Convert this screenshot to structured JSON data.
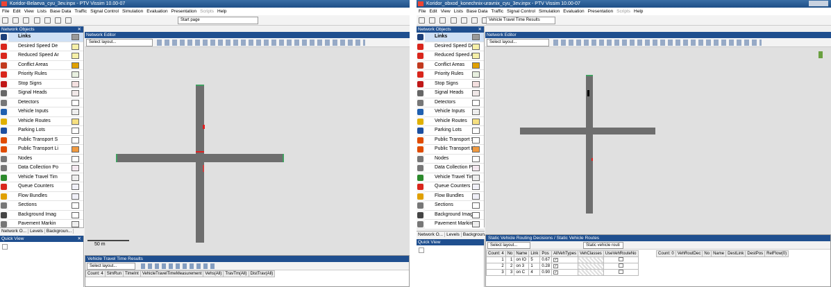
{
  "left_window": {
    "title": "Koridor-Belaeva_cyu_3ev.inpx - PTV Vissim 10.00-07",
    "menu": [
      "File",
      "Edit",
      "View",
      "Lists",
      "Base Data",
      "Traffic",
      "Signal Control",
      "Simulation",
      "Evaluation",
      "Presentation",
      "Scripts",
      "Help"
    ],
    "toolbar_select": "Start page",
    "network_objects_title": "Network Objects",
    "network_editor_title": "Network Editor",
    "layout_select": "Select layout...",
    "scale_label": "50 m",
    "objects": [
      {
        "label": "Links",
        "selected": true,
        "icon_color": "#1c3f7a",
        "swatch": "#9a9a9a"
      },
      {
        "label": "Desired Speed De",
        "icon_color": "#d9261c",
        "swatch": "#f6f0a8"
      },
      {
        "label": "Reduced Speed Ar",
        "icon_color": "#d9261c",
        "swatch": "#f6f0a8"
      },
      {
        "label": "Conflict Areas",
        "icon_color": "#c23a1f",
        "swatch": "#e0a000"
      },
      {
        "label": "Priority Rules",
        "icon_color": "#d9261c",
        "swatch": "#e8f0e0"
      },
      {
        "label": "Stop Signs",
        "icon_color": "#c01818",
        "swatch": "#f4e0e0"
      },
      {
        "label": "Signal Heads",
        "icon_color": "#666666",
        "swatch": "#f0e8e8"
      },
      {
        "label": "Detectors",
        "icon_color": "#777777",
        "swatch": "#ffffff"
      },
      {
        "label": "Vehicle Inputs",
        "icon_color": "#2060b0",
        "swatch": "#eeeeee"
      },
      {
        "label": "Vehicle Routes",
        "icon_color": "#e0b000",
        "swatch": "#f6e080"
      },
      {
        "label": "Parking Lots",
        "icon_color": "#1c4fa0",
        "swatch": "#ffffff"
      },
      {
        "label": "Public Transport S",
        "icon_color": "#e04c00",
        "swatch": "#ffffff"
      },
      {
        "label": "Public Transport Li",
        "icon_color": "#e04c00",
        "swatch": "#f09a40"
      },
      {
        "label": "Nodes",
        "icon_color": "#777777",
        "swatch": "#ffffff"
      },
      {
        "label": "Data Collection Po",
        "icon_color": "#777777",
        "swatch": "#f4e8f0"
      },
      {
        "label": "Vehicle Travel Tim",
        "icon_color": "#2c8a2c",
        "swatch": "#eeeeee"
      },
      {
        "label": "Queue Counters",
        "icon_color": "#d9261c",
        "swatch": "#f0f0f8"
      },
      {
        "label": "Flow Bundles",
        "icon_color": "#e0a000",
        "swatch": "#f0f0f8"
      },
      {
        "label": "Sections",
        "icon_color": "#777777",
        "swatch": "#ffffff"
      },
      {
        "label": "Background Imag",
        "icon_color": "#444444",
        "swatch": "#ffffff"
      },
      {
        "label": "Pavement Markin",
        "icon_color": "#777777",
        "swatch": "#eeeeee"
      }
    ],
    "bottom_tabs": [
      "Network O...",
      "Levels",
      "Backgroun..."
    ],
    "quick_view_title": "Quick View",
    "results_title": "Vehicle Travel Time Results",
    "results_layout_select": "Select layout...",
    "results_count": "Count: 4",
    "results_columns": [
      "SimRun",
      "TimeInt",
      "VehicleTravelTimeMeasurement",
      "Vehs(All)",
      "TravTm(All)",
      "DistTrav(All)"
    ]
  },
  "right_window": {
    "title": "Koridor_obxod_konechnix-uravnix_cyu_3ev.inpx - PTV Vissim 10.00-07",
    "menu": [
      "File",
      "Edit",
      "View",
      "Lists",
      "Base Data",
      "Traffic",
      "Signal Control",
      "Simulation",
      "Evaluation",
      "Presentation",
      "Scripts",
      "Help"
    ],
    "toolbar_select": "Vehicle Travel Time Results",
    "network_objects_title": "Network Objects",
    "network_editor_title": "Network Editor",
    "layout_select": "Select layout...",
    "objects": [
      {
        "label": "Links",
        "selected": true,
        "icon_color": "#1c3f7a",
        "swatch": "#9a9a9a"
      },
      {
        "label": "Desired Speed De",
        "icon_color": "#d9261c",
        "swatch": "#f6f0a8"
      },
      {
        "label": "Reduced Speed Ar",
        "icon_color": "#d9261c",
        "swatch": "#f6f0a8"
      },
      {
        "label": "Conflict Areas",
        "icon_color": "#c23a1f",
        "swatch": "#e0a000"
      },
      {
        "label": "Priority Rules",
        "icon_color": "#d9261c",
        "swatch": "#e8f0e0"
      },
      {
        "label": "Stop Signs",
        "icon_color": "#c01818",
        "swatch": "#f4e0e0"
      },
      {
        "label": "Signal Heads",
        "icon_color": "#666666",
        "swatch": "#f0e8e8"
      },
      {
        "label": "Detectors",
        "icon_color": "#777777",
        "swatch": "#ffffff"
      },
      {
        "label": "Vehicle Inputs",
        "icon_color": "#2060b0",
        "swatch": "#eeeeee"
      },
      {
        "label": "Vehicle Routes",
        "icon_color": "#e0b000",
        "swatch": "#f6e080"
      },
      {
        "label": "Parking Lots",
        "icon_color": "#1c4fa0",
        "swatch": "#ffffff"
      },
      {
        "label": "Public Transport S",
        "icon_color": "#e04c00",
        "swatch": "#ffffff"
      },
      {
        "label": "Public Transport Li",
        "icon_color": "#e04c00",
        "swatch": "#f09a40"
      },
      {
        "label": "Nodes",
        "icon_color": "#777777",
        "swatch": "#ffffff"
      },
      {
        "label": "Data Collection Po",
        "icon_color": "#777777",
        "swatch": "#f4e8f0"
      },
      {
        "label": "Vehicle Travel Tim",
        "icon_color": "#2c8a2c",
        "swatch": "#eeeeee"
      },
      {
        "label": "Queue Counters",
        "icon_color": "#d9261c",
        "swatch": "#f0f0f8"
      },
      {
        "label": "Flow Bundles",
        "icon_color": "#e0a000",
        "swatch": "#f0f0f8"
      },
      {
        "label": "Sections",
        "icon_color": "#777777",
        "swatch": "#ffffff"
      },
      {
        "label": "Background Imag",
        "icon_color": "#444444",
        "swatch": "#ffffff"
      },
      {
        "label": "Pavement Markin",
        "icon_color": "#777777",
        "swatch": "#eeeeee"
      }
    ],
    "bottom_tabs": [
      "Network O...",
      "Levels",
      "Backgroun..."
    ],
    "quick_view_title": "Quick View",
    "routes_title": "Static Vehicle Routing Decisions / Static Vehicle Routes",
    "routes_layout_select": "Select layout...",
    "routes_filter_select": "Static vehicle routi",
    "routes_count": "Count: 4",
    "routes_columns": [
      "No",
      "Name",
      "Link",
      "Pos",
      "AllVehTypes",
      "VehClasses",
      "UseVehRouteNo"
    ],
    "routes_rows": [
      {
        "idx": "1",
        "no": "1",
        "name": "on IO",
        "link": "5",
        "pos": "0.67",
        "allveh": "✓"
      },
      {
        "idx": "2",
        "no": "2",
        "name": "on 3",
        "link": "1",
        "pos": "0.28",
        "allveh": "✓"
      },
      {
        "idx": "3",
        "no": "3",
        "name": "on C",
        "link": "4",
        "pos": "0.90",
        "allveh": "✓"
      }
    ],
    "routes2_count": "Count: 0",
    "routes2_columns": [
      "VehRoutDec",
      "No",
      "Name",
      "DestLink",
      "DestPos",
      "RelFlow(0)"
    ]
  }
}
